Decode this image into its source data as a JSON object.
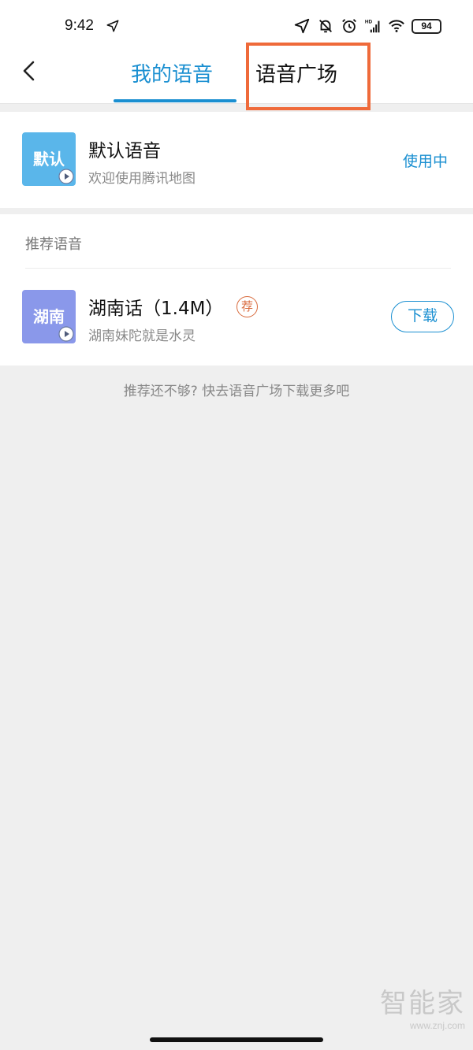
{
  "status_bar": {
    "time": "9:42",
    "battery": "94",
    "icons": [
      "location-arrow-icon",
      "bell-off-icon",
      "alarm-icon",
      "hd-signal-icon",
      "wifi-icon",
      "battery-icon"
    ]
  },
  "nav": {
    "tabs": [
      {
        "label": "我的语音",
        "active": true
      },
      {
        "label": "语音广场",
        "active": false
      }
    ],
    "accent_color": "#1a8fd1",
    "highlight_color": "#ef6a3a"
  },
  "default_voice": {
    "thumb_label": "默认",
    "title": "默认语音",
    "desc": "欢迎使用腾讯地图",
    "status": "使用中"
  },
  "recommend": {
    "section_label": "推荐语音",
    "items": [
      {
        "thumb_label": "湖南",
        "title": "湖南话（1.4M）",
        "badge": "荐",
        "desc": "湖南妹陀就是水灵",
        "action": "下载"
      }
    ]
  },
  "footer_hint": "推荐还不够? 快去语音广场下载更多吧",
  "watermark": {
    "text": "智能家",
    "url": "www.znj.com"
  }
}
